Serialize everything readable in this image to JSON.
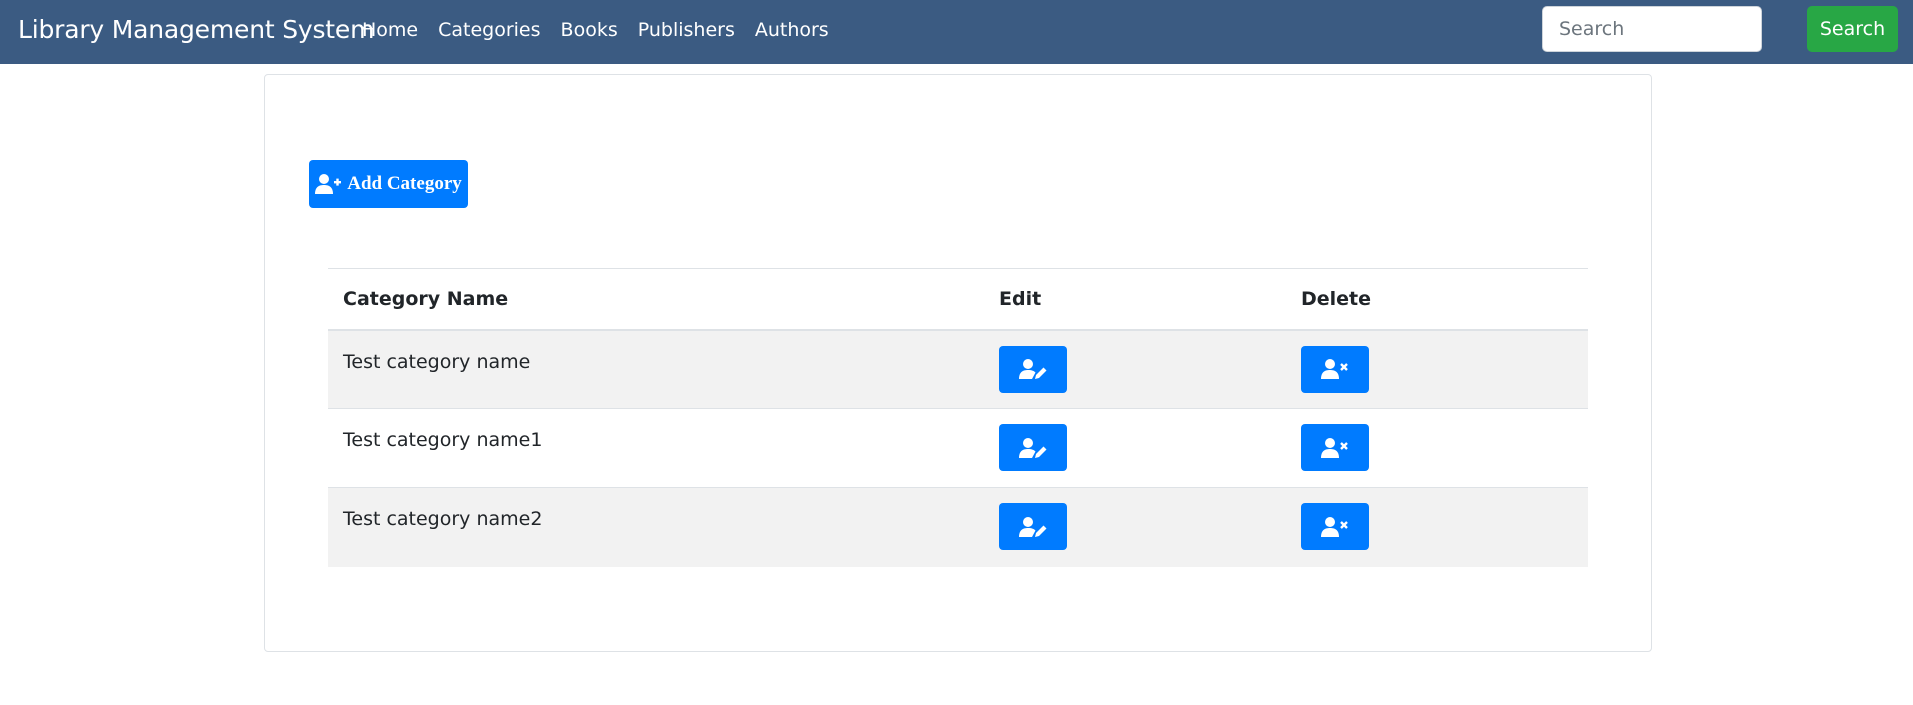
{
  "navbar": {
    "brand": "Library Management System",
    "links": [
      "Home",
      "Categories",
      "Books",
      "Publishers",
      "Authors"
    ],
    "search_placeholder": "Search",
    "search_button": "Search"
  },
  "main": {
    "add_button_label": "Add Category",
    "table": {
      "headers": [
        "Category Name",
        "Edit",
        "Delete"
      ],
      "rows": [
        {
          "name": "Test category name"
        },
        {
          "name": "Test category name1"
        },
        {
          "name": "Test category name2"
        }
      ]
    }
  },
  "icons": {
    "add": "user-plus-icon",
    "edit": "user-edit-icon",
    "delete": "user-times-icon"
  },
  "colors": {
    "navbar": "#3b5b82",
    "primary": "#007bff",
    "success": "#28a745"
  }
}
